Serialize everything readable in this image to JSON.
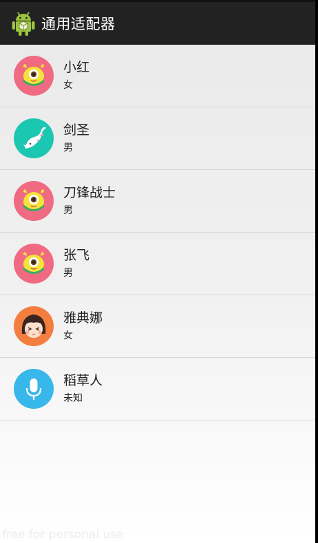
{
  "action_bar": {
    "title": "通用适配器",
    "icon": "android-icon"
  },
  "items": [
    {
      "name": "小红",
      "gender": "女",
      "avatar": "minion-avatar",
      "avatar_color": "#f06a82"
    },
    {
      "name": "剑圣",
      "gender": "男",
      "avatar": "fish-avatar",
      "avatar_color": "#1cc7b2"
    },
    {
      "name": "刀锋战士",
      "gender": "男",
      "avatar": "minion-avatar",
      "avatar_color": "#f06a82"
    },
    {
      "name": "张飞",
      "gender": "男",
      "avatar": "minion-avatar",
      "avatar_color": "#f06a82"
    },
    {
      "name": "雅典娜",
      "gender": "女",
      "avatar": "girl-avatar",
      "avatar_color": "#f47e3f"
    },
    {
      "name": "稻草人",
      "gender": "未知",
      "avatar": "microphone-avatar",
      "avatar_color": "#37b7ea"
    }
  ],
  "watermark": "free for personal use"
}
